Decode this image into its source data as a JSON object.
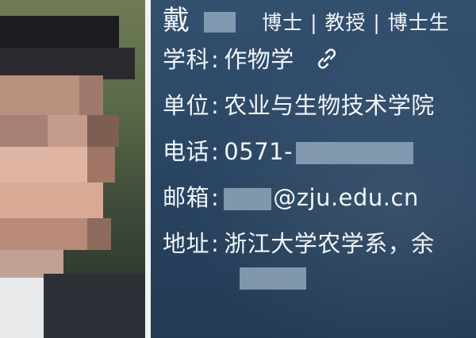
{
  "profile": {
    "surname": "戴",
    "titles": "博士 | 教授 | 博士生",
    "fields": [
      {
        "label": "学科",
        "value": "作物学",
        "icon": "link-icon"
      },
      {
        "label": "单位",
        "value": "农业与生物技术学院"
      },
      {
        "label": "电话",
        "value": "0571-"
      },
      {
        "label": "邮箱",
        "value": "@zju.edu.cn"
      },
      {
        "label": "地址",
        "value": "浙江大学农学系，余"
      }
    ],
    "colon": ":"
  },
  "colors": {
    "card_bg": "#2a4663",
    "text": "#f3f5f7",
    "divider": "#f2f2f2"
  }
}
